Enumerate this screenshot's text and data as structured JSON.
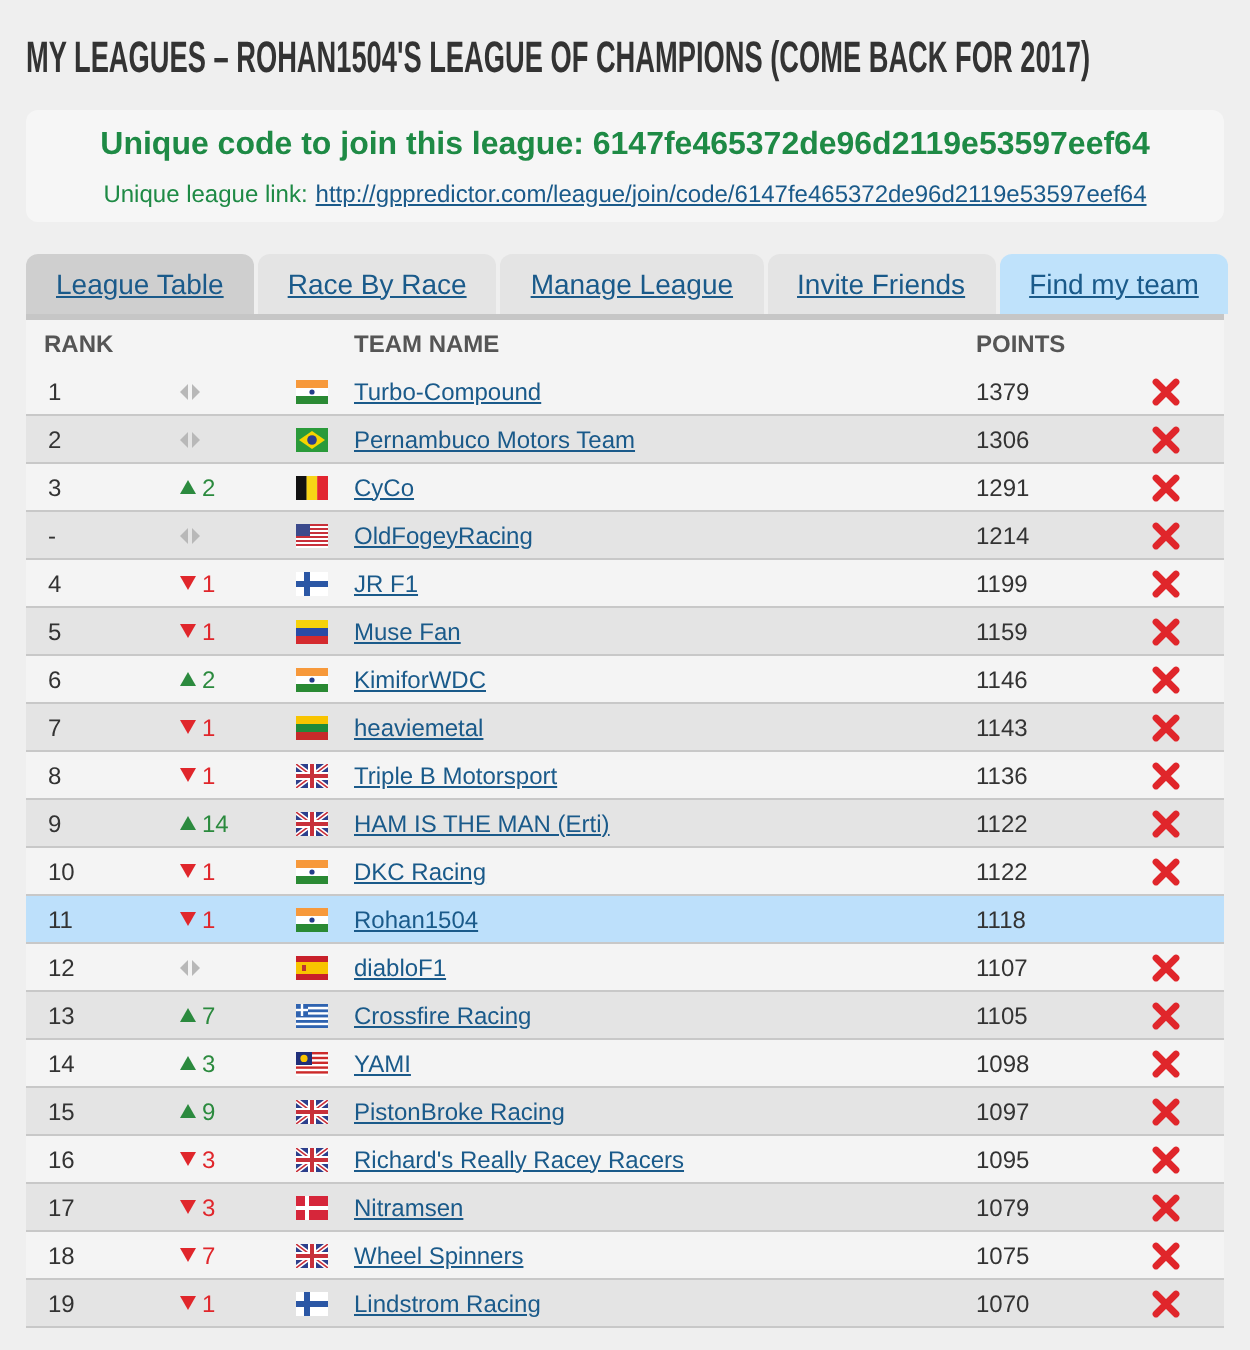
{
  "page_title": "MY LEAGUES – ROHAN1504'S LEAGUE OF CHAMPIONS (COME BACK FOR 2017)",
  "join_box": {
    "code_line": "Unique code to join this league: 6147fe465372de96d2119e53597eef64",
    "link_label": "Unique league link:",
    "link": "http://gppredictor.com/league/join/code/6147fe465372de96d2119e53597eef64"
  },
  "tabs": [
    {
      "label": "League Table",
      "selected": true,
      "kind": "tab"
    },
    {
      "label": "Race By Race",
      "selected": false,
      "kind": "tab"
    },
    {
      "label": "Manage League",
      "selected": false,
      "kind": "tab"
    },
    {
      "label": "Invite Friends",
      "selected": false,
      "kind": "tab"
    },
    {
      "label": "Find my team",
      "selected": false,
      "kind": "action"
    }
  ],
  "table": {
    "columns": [
      "RANK",
      "TEAM NAME",
      "POINTS"
    ],
    "rows": [
      {
        "rank": "1",
        "movement": {
          "kind": "same"
        },
        "flag": {
          "kind": "in"
        },
        "team": "Turbo-Compound",
        "points": "1379",
        "selected": false
      },
      {
        "rank": "2",
        "movement": {
          "kind": "same"
        },
        "flag": {
          "kind": "br"
        },
        "team": "Pernambuco Motors Team",
        "points": "1306",
        "selected": false
      },
      {
        "rank": "3",
        "movement": {
          "kind": "up",
          "change": "2"
        },
        "flag": {
          "kind": "be"
        },
        "team": "CyCo",
        "points": "1291",
        "selected": false
      },
      {
        "rank": "-",
        "movement": {
          "kind": "same"
        },
        "flag": {
          "kind": "us"
        },
        "team": "OldFogeyRacing",
        "points": "1214",
        "selected": false
      },
      {
        "rank": "4",
        "movement": {
          "kind": "down",
          "change": "1"
        },
        "flag": {
          "kind": "fi"
        },
        "team": "JR F1",
        "points": "1199",
        "selected": false
      },
      {
        "rank": "5",
        "movement": {
          "kind": "down",
          "change": "1"
        },
        "flag": {
          "kind": "ve"
        },
        "team": "Muse Fan",
        "points": "1159",
        "selected": false
      },
      {
        "rank": "6",
        "movement": {
          "kind": "up",
          "change": "2"
        },
        "flag": {
          "kind": "in"
        },
        "team": "KimiforWDC",
        "points": "1146",
        "selected": false
      },
      {
        "rank": "7",
        "movement": {
          "kind": "down",
          "change": "1"
        },
        "flag": {
          "kind": "lt"
        },
        "team": "heaviemetal",
        "points": "1143",
        "selected": false
      },
      {
        "rank": "8",
        "movement": {
          "kind": "down",
          "change": "1"
        },
        "flag": {
          "kind": "gb"
        },
        "team": "Triple B Motorsport",
        "points": "1136",
        "selected": false
      },
      {
        "rank": "9",
        "movement": {
          "kind": "up",
          "change": "14"
        },
        "flag": {
          "kind": "gb"
        },
        "team": "HAM IS THE MAN (Erti)",
        "points": "1122",
        "selected": false
      },
      {
        "rank": "10",
        "movement": {
          "kind": "down",
          "change": "1"
        },
        "flag": {
          "kind": "in"
        },
        "team": "DKC Racing",
        "points": "1122",
        "selected": false
      },
      {
        "rank": "11",
        "movement": {
          "kind": "down",
          "change": "1"
        },
        "flag": {
          "kind": "in"
        },
        "team": "Rohan1504",
        "points": "1118",
        "selected": true
      },
      {
        "rank": "12",
        "movement": {
          "kind": "same"
        },
        "flag": {
          "kind": "es"
        },
        "team": "diabloF1",
        "points": "1107",
        "selected": false
      },
      {
        "rank": "13",
        "movement": {
          "kind": "up",
          "change": "7"
        },
        "flag": {
          "kind": "gr"
        },
        "team": "Crossfire Racing",
        "points": "1105",
        "selected": false
      },
      {
        "rank": "14",
        "movement": {
          "kind": "up",
          "change": "3"
        },
        "flag": {
          "kind": "my"
        },
        "team": "YAMI",
        "points": "1098",
        "selected": false
      },
      {
        "rank": "15",
        "movement": {
          "kind": "up",
          "change": "9"
        },
        "flag": {
          "kind": "gb"
        },
        "team": "PistonBroke Racing",
        "points": "1097",
        "selected": false
      },
      {
        "rank": "16",
        "movement": {
          "kind": "down",
          "change": "3"
        },
        "flag": {
          "kind": "gb"
        },
        "team": "Richard's Really Racey Racers",
        "points": "1095",
        "selected": false
      },
      {
        "rank": "17",
        "movement": {
          "kind": "down",
          "change": "3"
        },
        "flag": {
          "kind": "dk"
        },
        "team": "Nitramsen",
        "points": "1079",
        "selected": false
      },
      {
        "rank": "18",
        "movement": {
          "kind": "down",
          "change": "7"
        },
        "flag": {
          "kind": "gb"
        },
        "team": "Wheel Spinners",
        "points": "1075",
        "selected": false
      },
      {
        "rank": "19",
        "movement": {
          "kind": "down",
          "change": "1"
        },
        "flag": {
          "kind": "fi"
        },
        "team": "Lindstrom Racing",
        "points": "1070",
        "selected": false
      }
    ]
  }
}
